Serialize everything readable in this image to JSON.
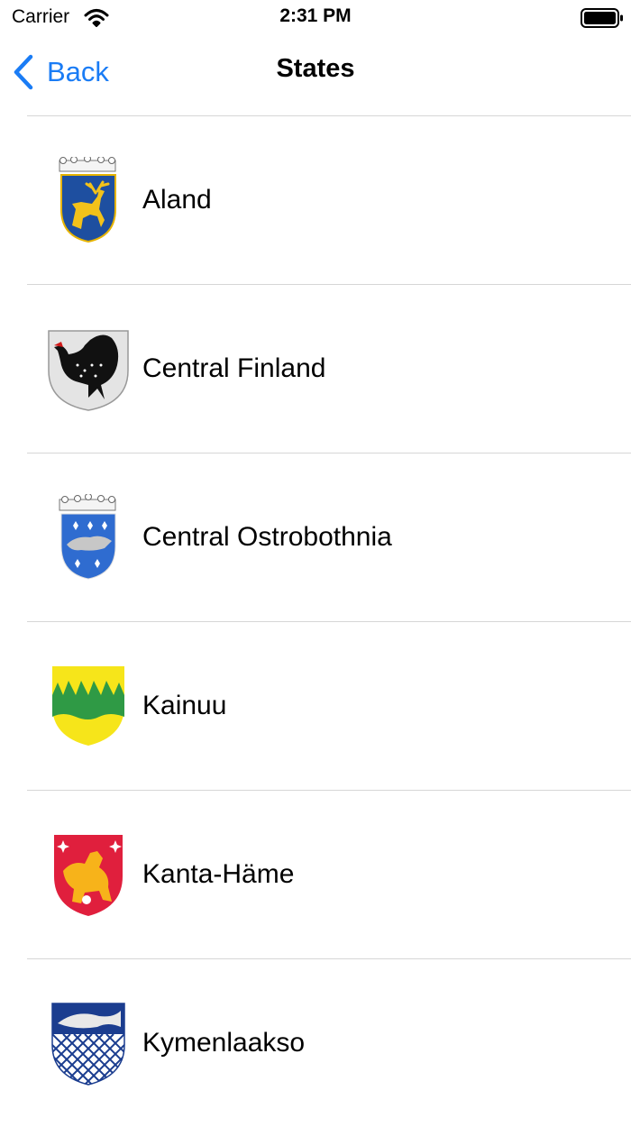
{
  "status_bar": {
    "carrier": "Carrier",
    "time": "2:31 PM"
  },
  "nav": {
    "back_label": "Back",
    "title": "States"
  },
  "states": [
    {
      "name": "Aland",
      "icon": "aland-coat-of-arms-icon"
    },
    {
      "name": "Central Finland",
      "icon": "central-finland-coat-of-arms-icon"
    },
    {
      "name": "Central Ostrobothnia",
      "icon": "central-ostrobothnia-coat-of-arms-icon"
    },
    {
      "name": "Kainuu",
      "icon": "kainuu-coat-of-arms-icon"
    },
    {
      "name": "Kanta-Häme",
      "icon": "kanta-hame-coat-of-arms-icon"
    },
    {
      "name": "Kymenlaakso",
      "icon": "kymenlaakso-coat-of-arms-icon"
    }
  ],
  "colors": {
    "accent": "#1a7cf5",
    "separator": "#d6d6d6"
  }
}
